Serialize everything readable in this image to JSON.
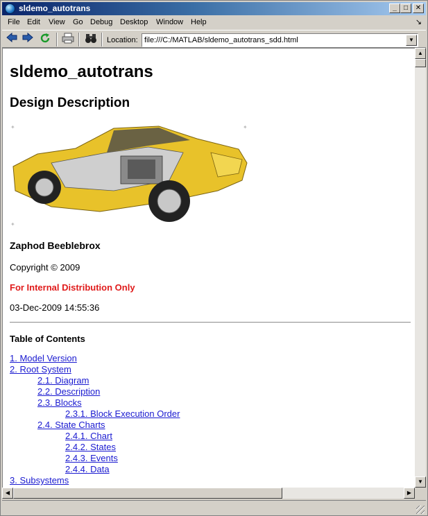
{
  "window": {
    "title": "sldemo_autotrans"
  },
  "menu": [
    "File",
    "Edit",
    "View",
    "Go",
    "Debug",
    "Desktop",
    "Window",
    "Help"
  ],
  "toolbar": {
    "location_label": "Location:",
    "location_value": "file:///C:/MATLAB/sldemo_autotrans_sdd.html",
    "icons": [
      "back-arrow-icon",
      "forward-arrow-icon",
      "refresh-icon",
      "print-icon",
      "find-binoculars-icon"
    ]
  },
  "page": {
    "title": "sldemo_autotrans",
    "subtitle": "Design Description",
    "author": "Zaphod Beeblebrox",
    "copyright": "Copyright © 2009",
    "distribution": "For Internal Distribution Only",
    "date": "03-Dec-2009 14:55:36",
    "toc_title": "Table of Contents",
    "toc": [
      {
        "level": 1,
        "label": "1. Model Version"
      },
      {
        "level": 1,
        "label": "2. Root System"
      },
      {
        "level": 2,
        "label": "2.1. Diagram"
      },
      {
        "level": 2,
        "label": "2.2. Description"
      },
      {
        "level": 2,
        "label": "2.3. Blocks"
      },
      {
        "level": 3,
        "label": "2.3.1. Block Execution Order"
      },
      {
        "level": 2,
        "label": "2.4. State Charts"
      },
      {
        "level": 3,
        "label": "2.4.1. Chart"
      },
      {
        "level": 3,
        "label": "2.4.2. States"
      },
      {
        "level": 3,
        "label": "2.4.3. Events"
      },
      {
        "level": 3,
        "label": "2.4.4. Data"
      },
      {
        "level": 1,
        "label": "3. Subsystems"
      }
    ]
  },
  "colors": {
    "title_bar_start": "#0a246a",
    "title_bar_end": "#a6caf0",
    "link": "#1a1ad0",
    "distribution_text": "#e01b1b",
    "car_body": "#e8c22a"
  }
}
